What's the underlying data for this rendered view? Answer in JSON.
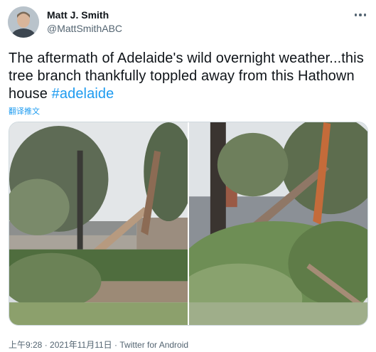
{
  "author": {
    "name": "Matt J. Smith",
    "handle": "@MattSmithABC"
  },
  "tweet": {
    "text": "The aftermath of Adelaide's wild overnight weather...this tree branch thankfully toppled away from this Hathown house ",
    "hashtag": "#adelaide",
    "translate_label": "翻译推文"
  },
  "meta": {
    "time": "上午9:28",
    "separator": "·",
    "date": "2021年11月11日",
    "source": "Twitter for Android"
  },
  "icons": [
    "more-options-icon"
  ]
}
